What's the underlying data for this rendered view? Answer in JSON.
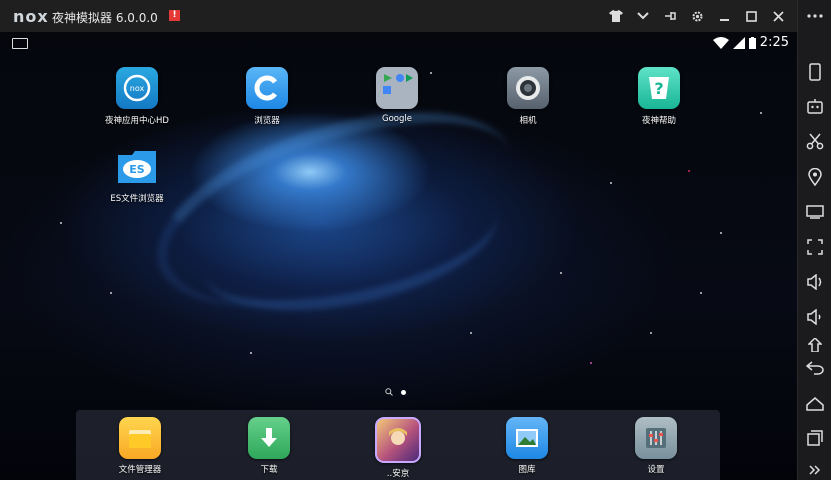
{
  "window": {
    "logo_text": "nox",
    "title": "夜神模拟器 6.0.0.0",
    "notice_badge": "!"
  },
  "titlebar_buttons": [
    "shirt-icon",
    "chevron-down-icon",
    "pin-icon",
    "gear-icon",
    "minimize-icon",
    "maximize-icon",
    "close-icon"
  ],
  "statusbar": {
    "time": "2:25"
  },
  "desktop": {
    "apps": [
      {
        "label": "夜神应用中心HD",
        "icon": "nox-app-center-icon"
      },
      {
        "label": "浏览器",
        "icon": "browser-icon"
      },
      {
        "label": "Google",
        "icon": "google-folder-icon"
      },
      {
        "label": "相机",
        "icon": "camera-icon"
      },
      {
        "label": "夜神帮助",
        "icon": "help-icon"
      },
      {
        "label": "ES文件浏览器",
        "icon": "es-file-explorer-icon"
      }
    ],
    "page_indicator": {
      "pages": 1,
      "current": 1
    }
  },
  "dock": {
    "apps": [
      {
        "label": "文件管理器",
        "icon": "folder-icon"
      },
      {
        "label": "下载",
        "icon": "download-icon"
      },
      {
        "label": "..安京",
        "icon": "game-icon"
      },
      {
        "label": "图库",
        "icon": "gallery-icon"
      },
      {
        "label": "设置",
        "icon": "settings-icon"
      }
    ]
  },
  "sidebar": {
    "buttons": [
      "more-icon",
      "rotate-icon",
      "robot-icon",
      "scissors-icon",
      "location-icon",
      "keyboard-icon",
      "fullscreen-icon",
      "volume-up-icon",
      "volume-down-icon",
      "install-apk-icon",
      "back-icon",
      "home-icon",
      "recents-icon"
    ]
  },
  "colors": {
    "titlebar": "#1f1f1f",
    "sidebar": "#1b1b1d",
    "accent_red": "#e53935"
  }
}
